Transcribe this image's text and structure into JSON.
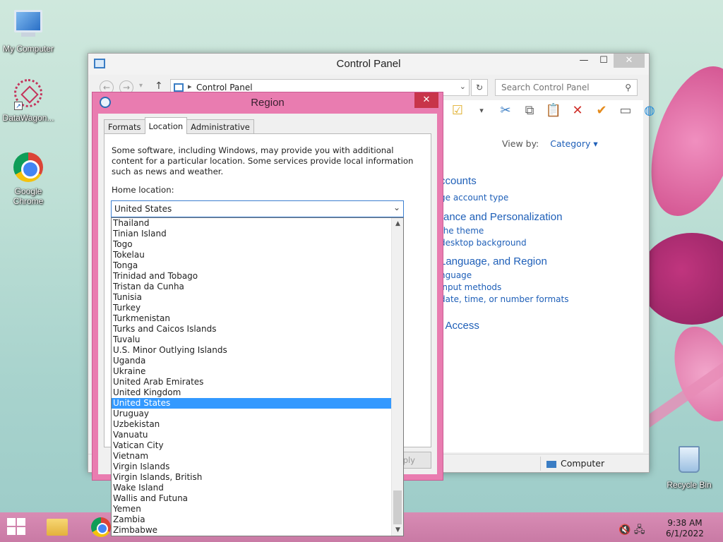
{
  "desktop": {
    "icons": [
      {
        "label": "My Computer",
        "icon": "computer-icon"
      },
      {
        "label": "DataWagon...",
        "icon": "datawagon-icon"
      },
      {
        "label": "Google Chrome",
        "icon": "chrome-icon"
      },
      {
        "label": "Recycle Bin",
        "icon": "recycle-bin-icon"
      }
    ]
  },
  "control_panel": {
    "title": "Control Panel",
    "address": "Control Panel",
    "search_placeholder": "Search Control Panel",
    "view_by_label": "View by:",
    "view_by_value": "Category ▾",
    "headings": [
      "ccounts",
      "rance and Personalization",
      "Language, and Region",
      "f Access"
    ],
    "links": [
      "ge account type",
      "the theme",
      "desktop background",
      "nguage",
      "input methods",
      "date, time, or number formats"
    ],
    "status_computer": "Computer"
  },
  "region_dialog": {
    "title": "Region",
    "tabs": [
      "Formats",
      "Location",
      "Administrative"
    ],
    "active_tab": "Location",
    "description": "Some software, including Windows, may provide you with additional content for a particular location. Some services provide local information such as news and weather.",
    "home_location_label": "Home location:",
    "selected": "United States",
    "apply_label": "pply",
    "options": [
      "Thailand",
      "Tinian Island",
      "Togo",
      "Tokelau",
      "Tonga",
      "Trinidad and Tobago",
      "Tristan da Cunha",
      "Tunisia",
      "Turkey",
      "Turkmenistan",
      "Turks and Caicos Islands",
      "Tuvalu",
      "U.S. Minor Outlying Islands",
      "Uganda",
      "Ukraine",
      "United Arab Emirates",
      "United Kingdom",
      "United States",
      "Uruguay",
      "Uzbekistan",
      "Vanuatu",
      "Vatican City",
      "Vietnam",
      "Virgin Islands",
      "Virgin Islands, British",
      "Wake Island",
      "Wallis and Futuna",
      "Yemen",
      "Zambia",
      "Zimbabwe"
    ]
  },
  "taskbar": {
    "time": "9:38 AM",
    "date": "6/1/2022"
  },
  "colors": {
    "dialog_frame": "#e97cb0",
    "selection": "#3399ff",
    "link": "#1e5fb8"
  }
}
